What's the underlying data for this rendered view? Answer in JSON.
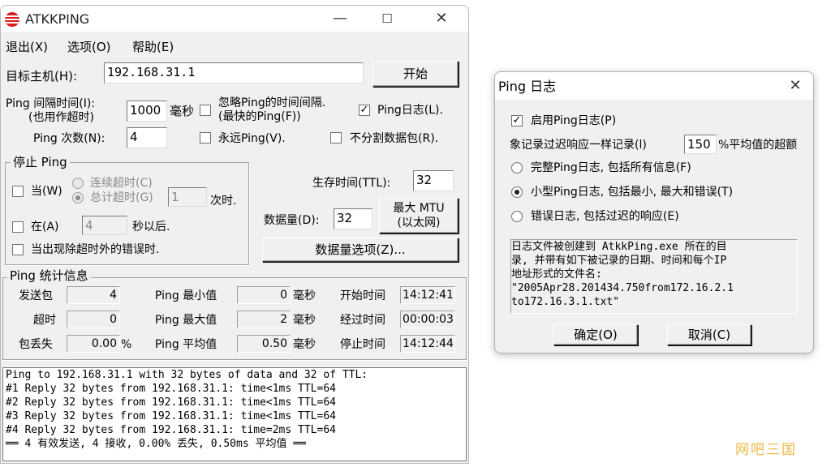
{
  "main": {
    "title": "ATKKPING",
    "menu": [
      "退出(X)",
      "选项(O)",
      "帮助(E)"
    ],
    "host_label": "目标主机(H):",
    "host_value": "192.168.31.1",
    "start_button": "开始",
    "interval_label_1": "Ping 间隔时间(I):",
    "interval_label_2": "(也用作超时)",
    "interval_value": "1000",
    "interval_unit": "毫秒",
    "ignore_interval_label_1": "忽略Ping的时间间隔.",
    "ignore_interval_label_2": "(最快的Ping(F))",
    "ping_log_check_label": "Ping日志(L).",
    "count_label": "Ping 次数(N):",
    "count_value": "4",
    "forever_label": "永远Ping(V).",
    "no_fragment_label": "不分割数据包(R).",
    "stop_group": {
      "title": "停止 Ping",
      "when_label": "当(W)",
      "consecutive_label": "连续超时(C)",
      "total_label": "总计超时(G)",
      "timeout_count": "1",
      "times_label": "次时.",
      "at_label": "在(A)",
      "seconds_value": "4",
      "seconds_label": "秒以后.",
      "error_label": "当出现除超时外的错误时."
    },
    "ttl_label": "生存时间(TTL):",
    "ttl_value": "32",
    "data_size_label": "数据量(D):",
    "data_size_value": "32",
    "max_mtu_1": "最大 MTU",
    "max_mtu_2": "(以太网)",
    "data_options_button": "数据量选项(Z)...",
    "stats": {
      "title": "Ping  统计信息",
      "sent_label": "发送包",
      "sent_value": "4",
      "timeout_label": "超时",
      "timeout_value": "0",
      "loss_label": "包丢失",
      "loss_value": "0.00",
      "percent": "%",
      "min_label": "Ping 最小值",
      "min_value": "0",
      "max_label": "Ping 最大值",
      "max_value": "2",
      "avg_label": "Ping 平均值",
      "avg_value": "0.50",
      "ms_unit": "毫秒",
      "start_label": "开始时间",
      "start_value": "14:12:41",
      "elapsed_label": "经过时间",
      "elapsed_value": "00:00:03",
      "stop_label": "停止时间",
      "stop_value": "14:12:44"
    },
    "log_lines": [
      "Ping to 192.168.31.1 with 32 bytes of data and 32 of TTL:",
      "#1 Reply 32 bytes from 192.168.31.1: time<1ms TTL=64",
      "#2 Reply 32 bytes from 192.168.31.1: time<1ms TTL=64",
      "#3 Reply 32 bytes from 192.168.31.1: time<1ms TTL=64",
      "#4 Reply 32 bytes from 192.168.31.1: time=2ms TTL=64",
      "══ 4 有效发送,   4 接收,     0.00% 丢失, 0.50ms 平均值  ══"
    ]
  },
  "dialog": {
    "title": "Ping 日志",
    "enable_label": "启用Ping日志(P)",
    "record_label_1": "象记录过迟响应一样记录(l)",
    "record_value": "150",
    "record_label_2": "%平均值的超额",
    "options": [
      "完整Ping日志, 包括所有信息(F)",
      "小型Ping日志, 包括最小, 最大和错误(T)",
      "错误日志, 包括过迟的响应(E)"
    ],
    "selected_option": 1,
    "note_lines": [
      "    日志文件被创建到 AtkkPing.exe 所在的目",
      "录, 并带有如下被记录的日期、时间和每个IP",
      "地址形式的文件名:",
      "\"2005Apr28.201434.750from172.16.2.1",
      "to172.16.3.1.txt\""
    ],
    "ok_button": "确定(O)",
    "cancel_button": "取消(C)"
  },
  "watermark": "网吧三国"
}
